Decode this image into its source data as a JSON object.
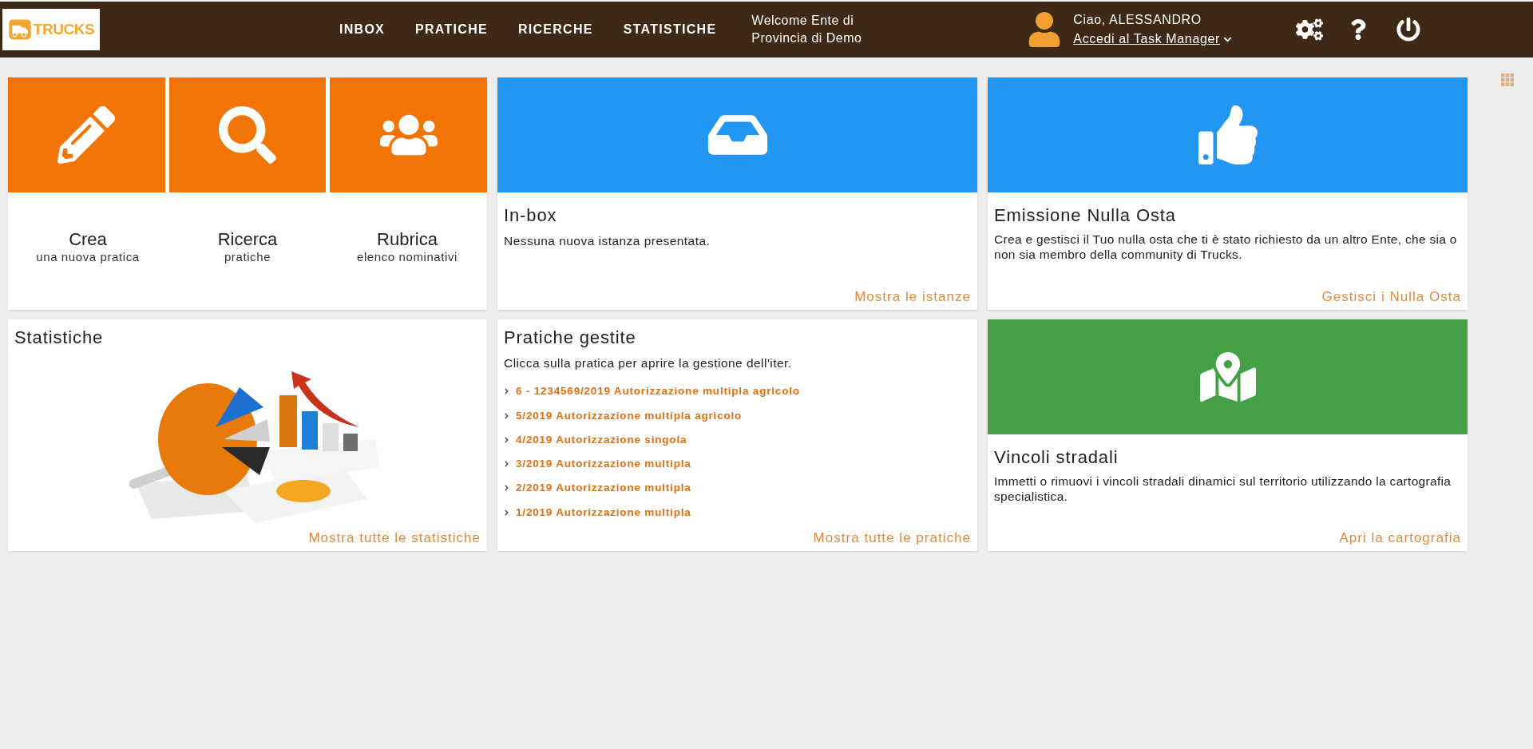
{
  "header": {
    "logo_text": "TRUCKS",
    "nav": [
      {
        "label": "INBOX"
      },
      {
        "label": "PRATICHE"
      },
      {
        "label": "RICERCHE"
      },
      {
        "label": "STATISTICHE"
      }
    ],
    "welcome": "Welcome Ente di Provincia di Demo",
    "greeting": "Ciao, ALESSANDRO",
    "task_manager_link": "Accedi al Task Manager"
  },
  "quick_actions": [
    {
      "title": "Crea",
      "subtitle": "una nuova pratica"
    },
    {
      "title": "Ricerca",
      "subtitle": "pratiche"
    },
    {
      "title": "Rubrica",
      "subtitle": "elenco nominativi"
    }
  ],
  "inbox": {
    "title": "In-box",
    "text": "Nessuna nuova istanza presentata.",
    "link": "Mostra le istanze"
  },
  "nulla_osta": {
    "title": "Emissione Nulla Osta",
    "text": "Crea e gestisci il Tuo nulla osta che ti è stato richiesto da un altro Ente, che sia o non sia membro della community di Trucks.",
    "link": "Gestisci i Nulla Osta"
  },
  "statistiche": {
    "title": "Statistiche",
    "link": "Mostra tutte le statistiche"
  },
  "pratiche": {
    "title": "Pratiche gestite",
    "text": "Clicca sulla pratica per aprire la gestione dell'iter.",
    "items": [
      "6 - 1234569/2019 Autorizzazione multipla agricolo",
      "5/2019 Autorizzazione multipla agricolo",
      "4/2019 Autorizzazione singola",
      "3/2019 Autorizzazione multipla",
      "2/2019 Autorizzazione multipla",
      "1/2019 Autorizzazione multipla"
    ],
    "link": "Mostra tutte le pratiche"
  },
  "vincoli": {
    "title": "Vincoli stradali",
    "text": "Immetti o rimuovi i vincoli stradali dinamici sul territorio utilizzando la cartografia specialistica.",
    "link": "Apri la cartografia"
  }
}
